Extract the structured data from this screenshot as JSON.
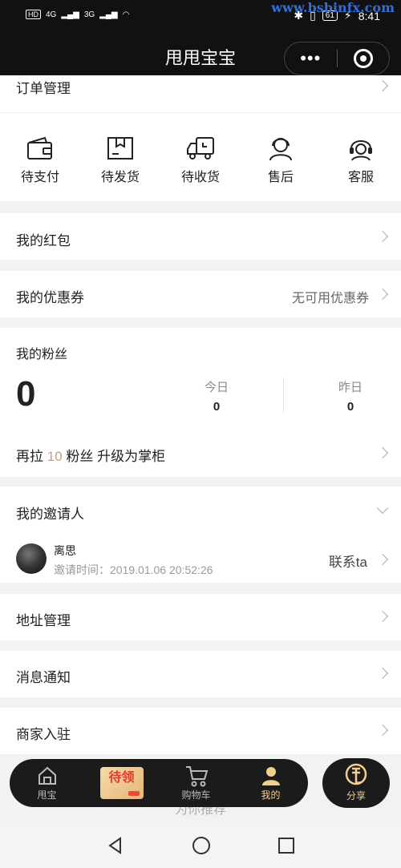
{
  "status_bar": {
    "hd": "HD",
    "signal1": "4G",
    "signal2": "3G",
    "battery": "61",
    "time": "8:41"
  },
  "watermark": "www.bsbinfx.com",
  "navbar": {
    "title": "甩甩宝宝",
    "more": "•••"
  },
  "order_section": {
    "title": "订单管理",
    "items": [
      {
        "label": "待支付",
        "icon": "wallet-icon"
      },
      {
        "label": "待发货",
        "icon": "box-icon"
      },
      {
        "label": "待收货",
        "icon": "truck-icon"
      },
      {
        "label": "售后",
        "icon": "agent-icon"
      },
      {
        "label": "客服",
        "icon": "headset-icon"
      }
    ]
  },
  "red_packet": {
    "label": "我的红包"
  },
  "coupons": {
    "label": "我的优惠券",
    "status": "无可用优惠券"
  },
  "fans": {
    "title": "我的粉丝",
    "total": "0",
    "today_label": "今日",
    "today_value": "0",
    "yesterday_label": "昨日",
    "yesterday_value": "0",
    "upgrade_prefix": "再拉",
    "upgrade_count": "10",
    "upgrade_suffix": "粉丝 升级为掌柜"
  },
  "inviter": {
    "title": "我的邀请人",
    "name": "离思",
    "time": "邀请时间：2019.01.06 20:52:26",
    "contact": "联系ta"
  },
  "address": {
    "label": "地址管理"
  },
  "messages": {
    "label": "消息通知"
  },
  "merchant": {
    "label": "商家入驻"
  },
  "tabbar": {
    "home": "甩宝",
    "coupon": "待领",
    "cart": "购物车",
    "mine": "我的",
    "share": "分享"
  },
  "recommend": "为你推荐",
  "colors": {
    "accent": "#f2d08c",
    "highlight": "#c79a8a",
    "bar": "#111111"
  }
}
